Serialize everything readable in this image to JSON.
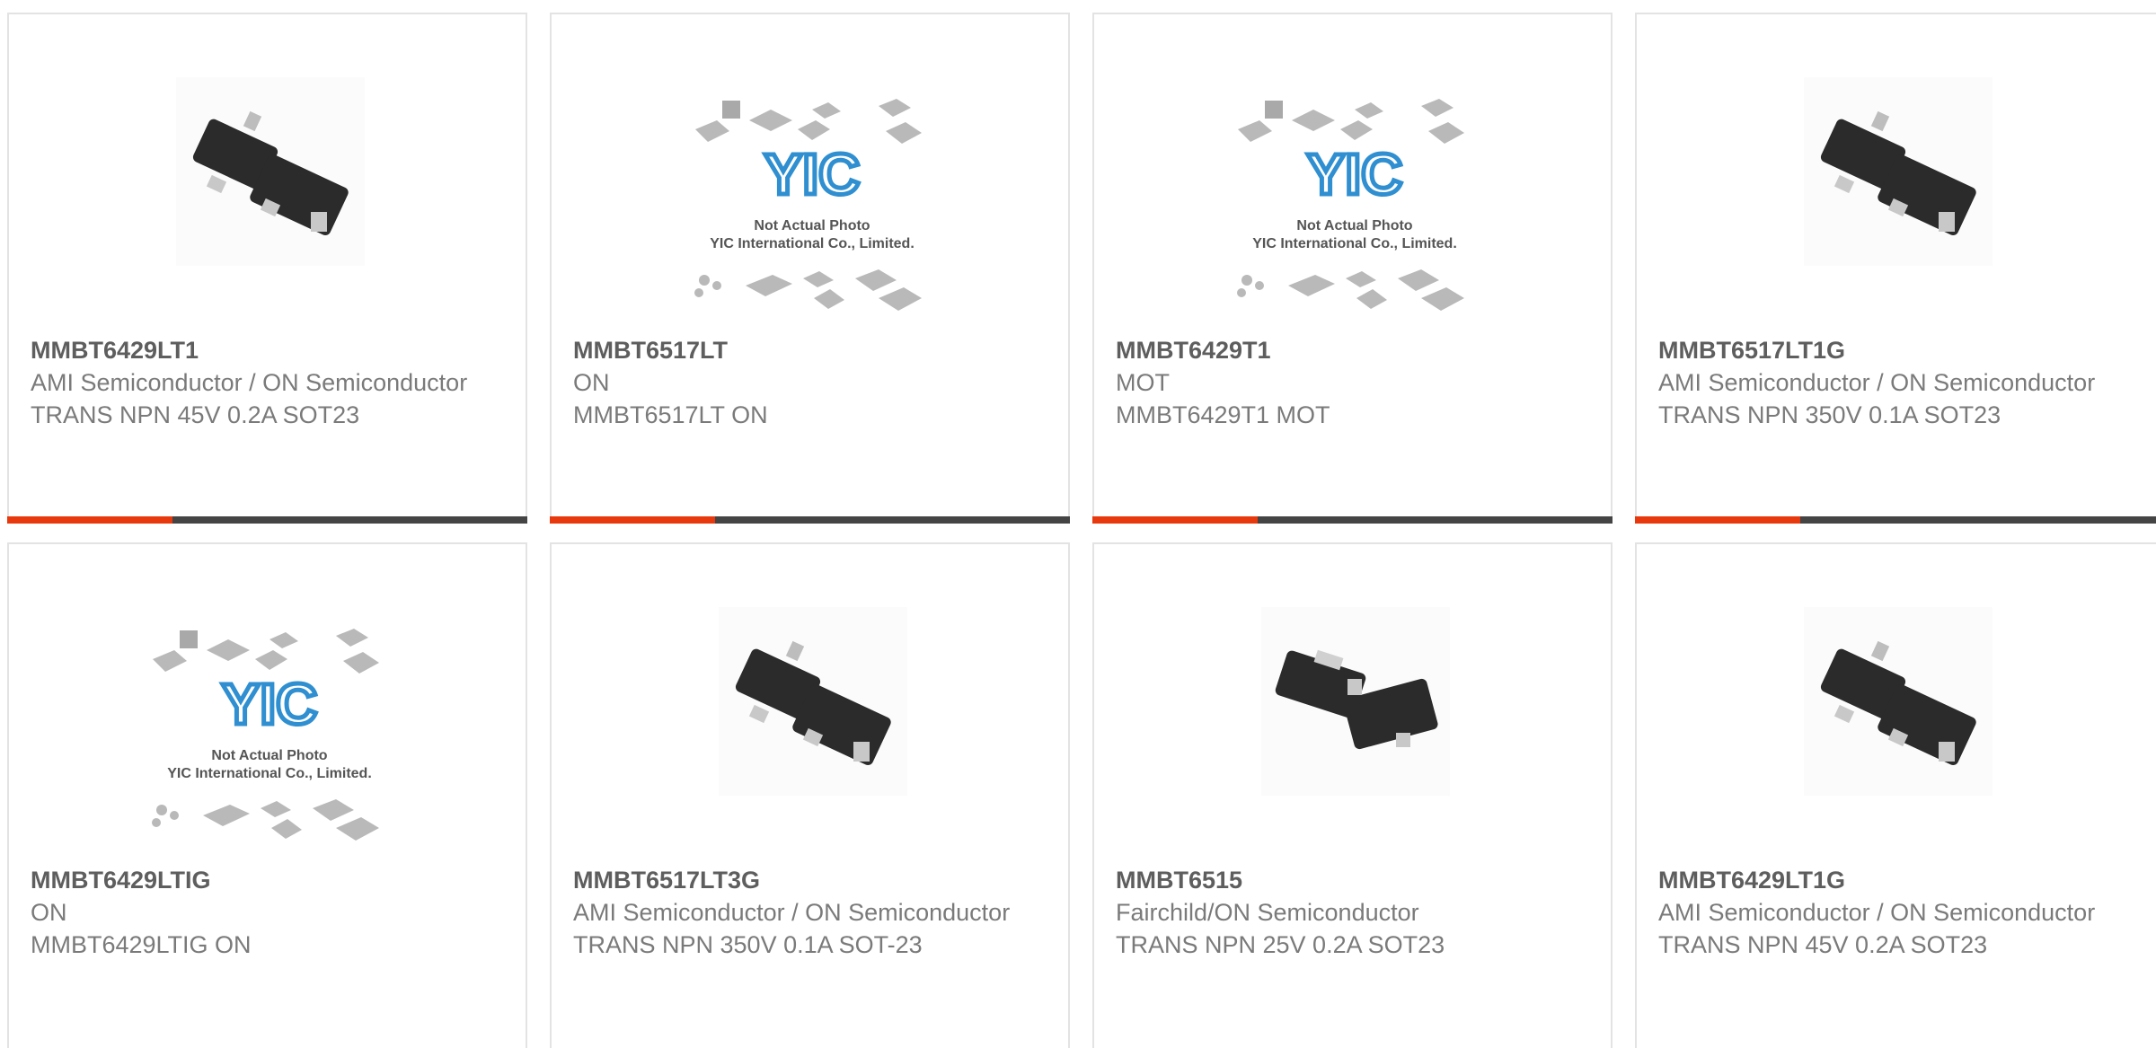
{
  "products": [
    {
      "part_number": "MMBT6429LT1",
      "manufacturer": "AMI Semiconductor / ON Semiconductor",
      "description": "TRANS NPN 45V 0.2A SOT23",
      "image": "sot23-photo"
    },
    {
      "part_number": "MMBT6517LT",
      "manufacturer": "ON",
      "description": "MMBT6517LT ON",
      "image": "yic-placeholder"
    },
    {
      "part_number": "MMBT6429T1",
      "manufacturer": "MOT",
      "description": "MMBT6429T1 MOT",
      "image": "yic-placeholder"
    },
    {
      "part_number": "MMBT6517LT1G",
      "manufacturer": "AMI Semiconductor / ON Semiconductor",
      "description": "TRANS NPN 350V 0.1A SOT23",
      "image": "sot23-photo"
    },
    {
      "part_number": "MMBT6429LTIG",
      "manufacturer": "ON",
      "description": "MMBT6429LTIG ON",
      "image": "yic-placeholder"
    },
    {
      "part_number": "MMBT6517LT3G",
      "manufacturer": "AMI Semiconductor / ON Semiconductor",
      "description": "TRANS NPN 350V 0.1A SOT-23",
      "image": "sot23-photo"
    },
    {
      "part_number": "MMBT6515",
      "manufacturer": "Fairchild/ON Semiconductor",
      "description": "TRANS NPN 25V 0.2A SOT23",
      "image": "sot23-photo-alt"
    },
    {
      "part_number": "MMBT6429LT1G",
      "manufacturer": "AMI Semiconductor / ON Semiconductor",
      "description": "TRANS NPN 45V 0.2A SOT23",
      "image": "sot23-photo"
    }
  ],
  "placeholder": {
    "logo_text": "YIC",
    "line1": "Not Actual Photo",
    "line2": "YIC International Co., Limited."
  },
  "colors": {
    "accent": "#e8380d",
    "bar": "#444444",
    "logo_blue": "#2f8fd0",
    "chip_dark": "#2b2b2b"
  }
}
